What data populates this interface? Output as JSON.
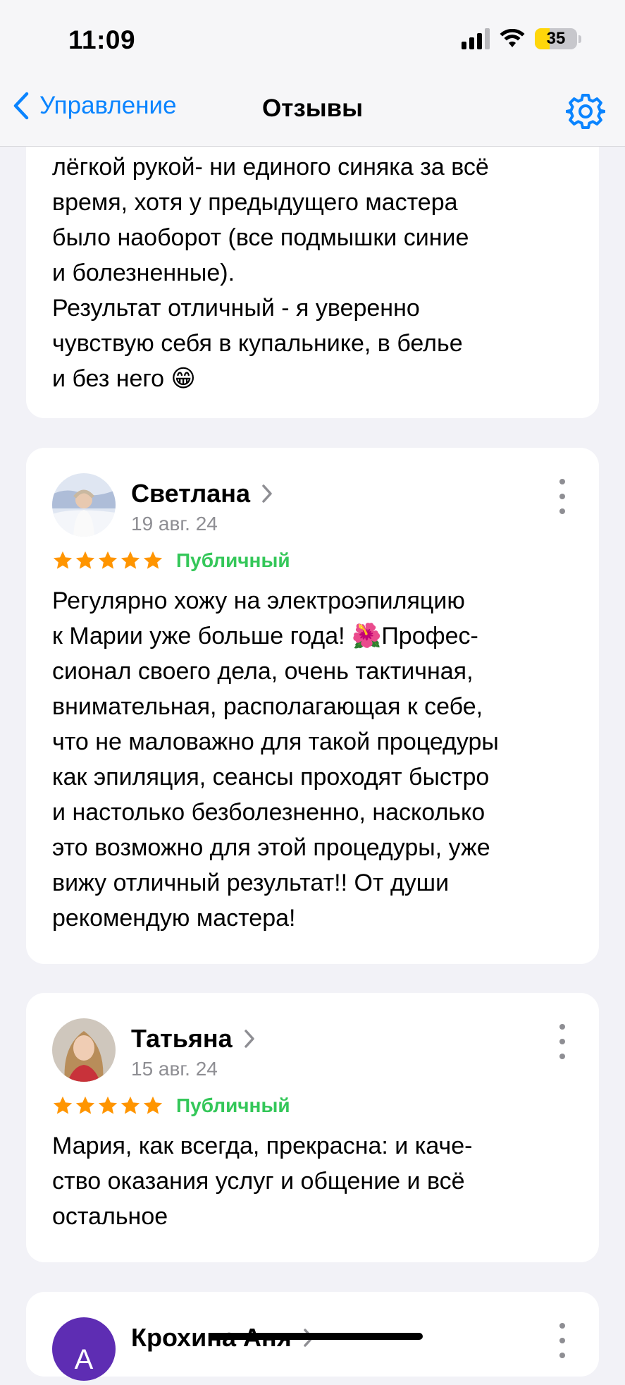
{
  "status_bar": {
    "time": "11:09",
    "battery": "35",
    "battery_level": 0.35
  },
  "nav": {
    "back_label": "Управление",
    "title": "Отзывы"
  },
  "colors": {
    "accent": "#0a84ff",
    "star": "#ff9500",
    "public_badge": "#34c759",
    "background": "#f2f2f7"
  },
  "reviews": [
    {
      "text": "лёгкой рукой- ни единого синяка за всё\nвремя, хотя у предыдущего мастера\nбыло наоборот (все подмышки синие\nи болезненные).\nРезультат отличный - я уверенно\nчувствую себя в купальнике, в белье\nи без него 😁"
    },
    {
      "name": "Светлана",
      "date": "19 авг. 24",
      "rating": 5,
      "badge": "Публичный",
      "text": "Регулярно хожу на электроэпиляцию\nк Марии уже больше года! 🌺Профес-\nсионал своего дела, очень тактичная,\nвнимательная, располагающая к себе,\nчто не маловажно для такой процедуры\nкак эпиляция, сеансы проходят быстро\nи настолько безболезненно, насколько\nэто возможно для этой процедуры, уже\nвижу отличный результат!! От души\nрекомендую мастера!"
    },
    {
      "name": "Татьяна",
      "date": "15 авг. 24",
      "rating": 5,
      "badge": "Публичный",
      "text": "Мария, как всегда, прекрасна: и каче-\nство оказания услуг и общение и всё\nостальное"
    },
    {
      "name": "Крохина Аня",
      "avatar_letter": "А"
    }
  ]
}
